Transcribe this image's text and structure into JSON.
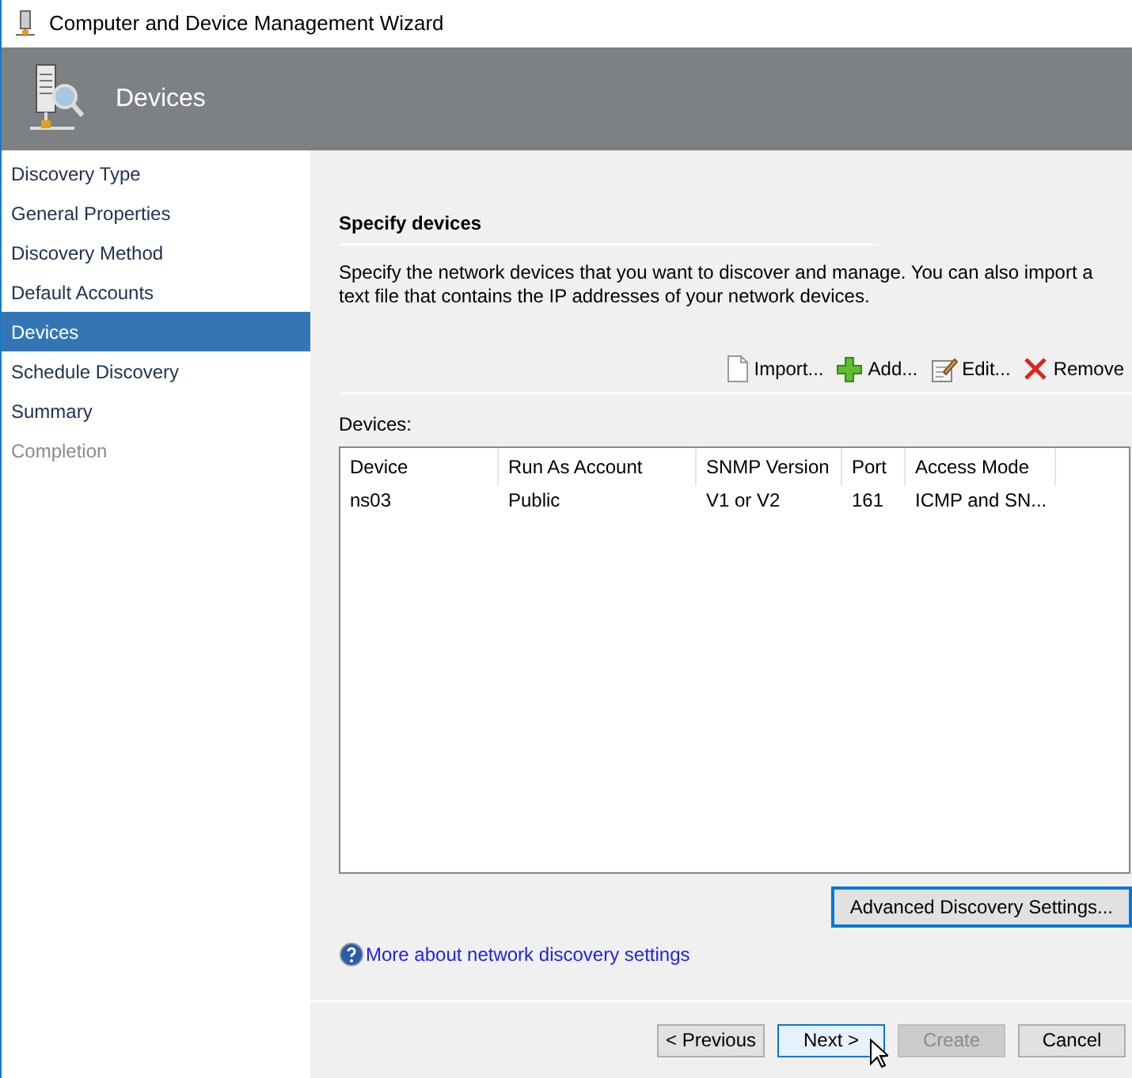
{
  "window": {
    "title": "Computer and Device Management Wizard"
  },
  "header": {
    "title": "Devices"
  },
  "sidebar": {
    "items": [
      {
        "label": "Discovery Type",
        "selected": false,
        "disabled": false
      },
      {
        "label": "General Properties",
        "selected": false,
        "disabled": false
      },
      {
        "label": "Discovery Method",
        "selected": false,
        "disabled": false
      },
      {
        "label": "Default Accounts",
        "selected": false,
        "disabled": false
      },
      {
        "label": "Devices",
        "selected": true,
        "disabled": false
      },
      {
        "label": "Schedule Discovery",
        "selected": false,
        "disabled": false
      },
      {
        "label": "Summary",
        "selected": false,
        "disabled": false
      },
      {
        "label": "Completion",
        "selected": false,
        "disabled": true
      }
    ]
  },
  "section": {
    "heading": "Specify devices",
    "description": "Specify the network devices that you want to discover and manage. You can also import a text file that contains the IP addresses of your network devices."
  },
  "toolbar": [
    {
      "kind": "import",
      "label": "Import..."
    },
    {
      "kind": "add",
      "label": "Add..."
    },
    {
      "kind": "edit",
      "label": "Edit..."
    },
    {
      "kind": "remove",
      "label": "Remove"
    }
  ],
  "table": {
    "label": "Devices:",
    "columns": [
      "Device",
      "Run As Account",
      "SNMP Version",
      "Port",
      "Access Mode"
    ],
    "rows": [
      [
        "ns03",
        "Public",
        "V1 or V2",
        "161",
        "ICMP and SN..."
      ]
    ]
  },
  "advanced_button": {
    "label": "Advanced Discovery Settings...",
    "focused": true
  },
  "help_link": "More about network discovery settings",
  "buttons": [
    {
      "label": "< Previous",
      "disabled": false,
      "focused": false
    },
    {
      "label": "Next >",
      "disabled": false,
      "focused": true
    },
    {
      "label": "Create",
      "disabled": true,
      "focused": false
    },
    {
      "label": "Cancel",
      "disabled": false,
      "focused": false
    }
  ]
}
